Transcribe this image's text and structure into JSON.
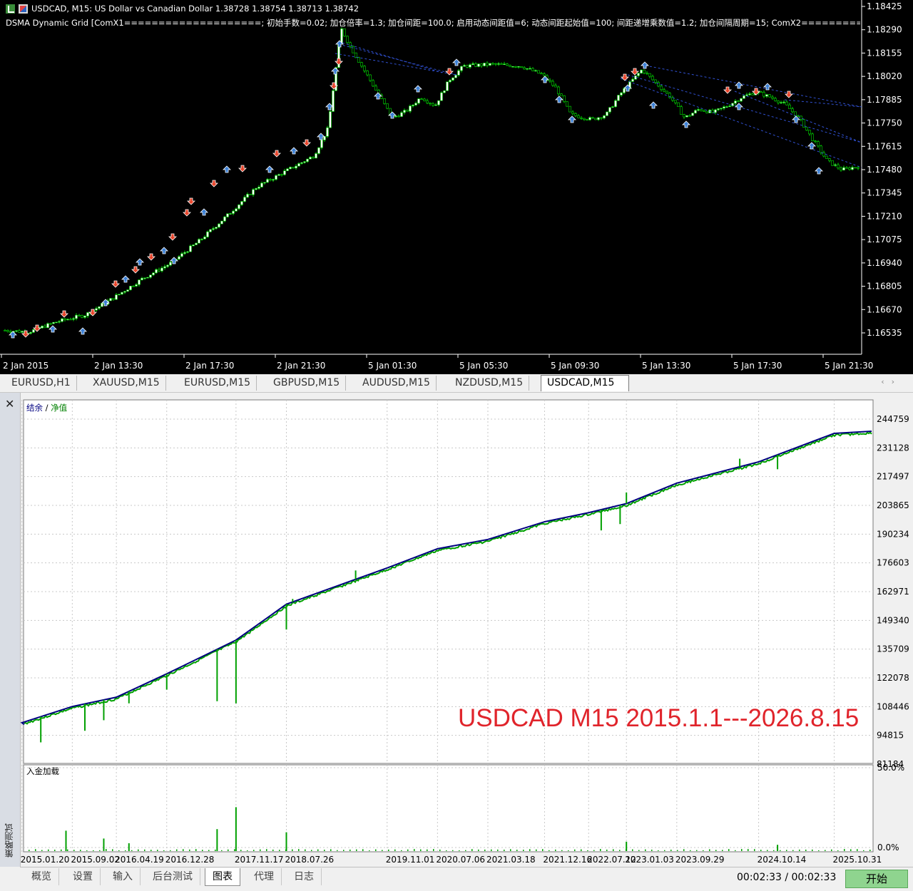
{
  "price_chart": {
    "header": "USDCAD, M15:  US Dollar vs Canadian Dollar  1.38728 1.38754 1.38713 1.38742",
    "indicator": "DSMA Dynamic Grid [ComX1====================; 初始手数=0.02; 加仓倍率=1.3; 加仓间距=100.0; 启用动态间距值=6; 动态间距起始值=100; 间距递增乘数值=1.2; 加仓间隔周期=15; ComX2==========",
    "y_ticks": [
      "1.18425",
      "1.18290",
      "1.18155",
      "1.18020",
      "1.17885",
      "1.17750",
      "1.17615",
      "1.17480",
      "1.17345",
      "1.17210",
      "1.17075",
      "1.16940",
      "1.16805",
      "1.16670",
      "1.16535"
    ],
    "x_ticks": [
      "2 Jan 2015",
      "2 Jan 13:30",
      "2 Jan 17:30",
      "2 Jan 21:30",
      "5 Jan 01:30",
      "5 Jan 05:30",
      "5 Jan 09:30",
      "5 Jan 13:30",
      "5 Jan 17:30",
      "5 Jan 21:30"
    ],
    "colors": {
      "bull": "#ffffff",
      "bear": "#000000",
      "wick": "#00e000",
      "buy_arrow": "#3a7fd5",
      "sell_arrow": "#e8442a",
      "grid_line": "#3050d0"
    }
  },
  "chart_tabs": [
    "EURUSD,H1",
    "XAUUSD,M15",
    "EURUSD,M15",
    "GBPUSD,M15",
    "AUDUSD,M15",
    "NZDUSD,M15",
    "USDCAD,M15"
  ],
  "active_chart_tab": "USDCAD,M15",
  "tester": {
    "legend_balance": "结余",
    "legend_separator": " / ",
    "legend_equity": "净值",
    "watermark": "USDCAD M15 2015.1.1---2026.8.15",
    "deposit_label": "入金加载",
    "deposit_ticks": [
      "50.0%",
      "0.0%"
    ],
    "side_label": "策略测试",
    "close_icon": "close-icon"
  },
  "chart_data": [
    {
      "type": "line",
      "title": "",
      "series": [
        {
          "name": "结余",
          "color": "#000080",
          "x": [
            "2015.01.20",
            "2015.09.02",
            "2016.04.19",
            "2016.12.28",
            "2017.11.17",
            "2018.07.26",
            "2019.11.01",
            "2020.07.06",
            "2021.03.18",
            "2021.12.16",
            "2022.07.12",
            "2023.01.03",
            "2023.09.29",
            "2024.10.14",
            "2025.10.31"
          ],
          "values": [
            100800,
            108500,
            112900,
            124000,
            140000,
            157000,
            174200,
            183300,
            187700,
            196100,
            200400,
            204700,
            214400,
            224500,
            238000
          ]
        },
        {
          "name": "净值",
          "color": "#00a000"
        }
      ],
      "drawdown_spikes": [
        {
          "x": "2015.04",
          "value": 91500
        },
        {
          "x": "2015.11",
          "value": 97000
        },
        {
          "x": "2016.02",
          "value": 102000
        },
        {
          "x": "2016.06",
          "value": 110000
        },
        {
          "x": "2016.12",
          "value": 116500
        },
        {
          "x": "2017.08",
          "value": 111000
        },
        {
          "x": "2017.11",
          "value": 110000
        },
        {
          "x": "2018.07",
          "value": 145000
        },
        {
          "x": "2018.08",
          "value": 159500
        },
        {
          "x": "2019.06",
          "value": 173000
        },
        {
          "x": "2021.01",
          "value": 186000
        },
        {
          "x": "2022.09",
          "value": 192000
        },
        {
          "x": "2022.12",
          "value": 195000
        },
        {
          "x": "2023.01",
          "value": 210000
        },
        {
          "x": "2024.07",
          "value": 226000
        },
        {
          "x": "2025.01",
          "value": 221000
        }
      ],
      "y_ticks": [
        "244759",
        "231128",
        "217497",
        "203865",
        "190234",
        "176603",
        "162971",
        "149340",
        "135709",
        "122078",
        "108446",
        "94815",
        "81184"
      ],
      "ylim": [
        81184,
        244759
      ],
      "x_ticks": [
        "2015.01.20",
        "2015.09.02",
        "2016.04.19",
        "2016.12.28",
        "2017.11.17",
        "2018.07.26",
        "2019.11.01",
        "2020.07.06",
        "2021.03.18",
        "2021.12.16",
        "2022.07.12",
        "2023.01.03",
        "2023.09.29",
        "2024.10.14",
        "2025.10.31"
      ],
      "grid": true
    },
    {
      "type": "bar",
      "title": "入金加载",
      "y_ticks": [
        "50.0%",
        "0.0%"
      ],
      "ylim": [
        0,
        50
      ],
      "values": [
        {
          "x": "2015.08",
          "value": 13
        },
        {
          "x": "2016.02",
          "value": 8
        },
        {
          "x": "2016.06",
          "value": 5
        },
        {
          "x": "2017.08",
          "value": 14
        },
        {
          "x": "2017.11",
          "value": 28
        },
        {
          "x": "2018.07",
          "value": 12
        },
        {
          "x": "2023.01",
          "value": 6
        },
        {
          "x": "2025.01",
          "value": 4
        }
      ]
    }
  ],
  "bottom_tabs": [
    "概览",
    "设置",
    "输入",
    "后台测试",
    "图表",
    "代理",
    "日志"
  ],
  "active_bottom_tab": "图表",
  "timer": "00:02:33 / 00:02:33",
  "start_button": "开始"
}
